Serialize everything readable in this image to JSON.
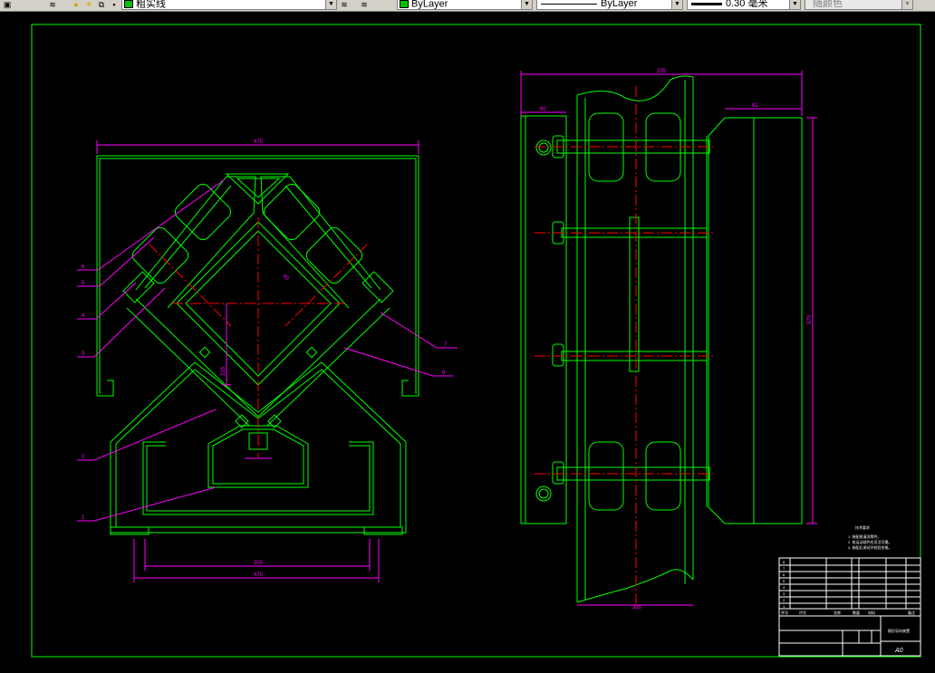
{
  "toolbar": {
    "layer_name": "粗实线",
    "color_label": "ByLayer",
    "linetype_label": "ByLayer",
    "lineweight_label": "0.30 毫米",
    "plotstyle_label": "随颜色",
    "colors": {
      "layer_swatch": "#00c000",
      "color_swatch": "#00c000"
    }
  },
  "drawing": {
    "front_view": {
      "dim_top": "475",
      "dim_diag": "60",
      "dim_vertical": "225",
      "dim_bottom_inner": "300",
      "dim_bottom_outer": "470",
      "balloons": [
        "6",
        "5",
        "4",
        "3",
        "2",
        "1",
        "7",
        "8"
      ]
    },
    "side_view": {
      "dim_top": "335",
      "dim_left": "60",
      "dim_right": "81",
      "dim_height": "570",
      "dim_bottom": "335"
    },
    "notes": {
      "heading": "技术要求",
      "items": [
        "1. 装配前清洗零件。",
        "2. 各运动部件应灵活可靠。",
        "3. 装配后调试并检验合格。"
      ]
    },
    "title_block": {
      "drawing_name": "楔形导向装置",
      "sheet_size": "A0",
      "bom_rows": [
        "8",
        "7",
        "6",
        "5",
        "4",
        "3",
        "2",
        "1"
      ],
      "bom_header": [
        "序号",
        "代号",
        "名称",
        "数量",
        "材料",
        "备注"
      ]
    },
    "colors": {
      "outline": "#00ff00",
      "dimension": "#ff00ff",
      "centerline": "#ff0000",
      "hidden": "#ffffff",
      "border": "#00ff00"
    }
  }
}
